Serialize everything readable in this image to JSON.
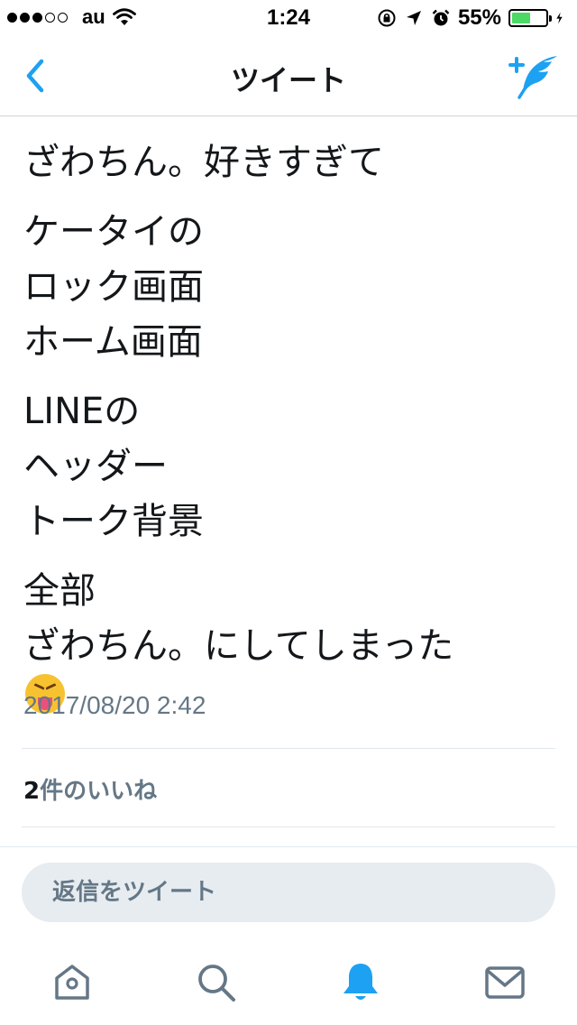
{
  "status_bar": {
    "signal_dots_filled": 3,
    "signal_dots_total": 5,
    "carrier": "au",
    "time": "1:24",
    "battery_percent": "55%",
    "battery_level": 0.55
  },
  "nav": {
    "title": "ツイート",
    "back_icon": "chevron-left-icon",
    "compose_icon": "compose-tweet-icon",
    "accent_color": "#1da1f2"
  },
  "tweet": {
    "paragraphs": [
      [
        "ざわちん。好きすぎて"
      ],
      [
        "ケータイの",
        "ロック画面",
        "ホーム画面"
      ],
      [
        "LINEの",
        "ヘッダー",
        "トーク背景"
      ],
      [
        "全部",
        "ざわちん。にしてしまった"
      ]
    ],
    "emoji": "squinting-face-with-tongue",
    "timestamp": "2017/08/20 2:42"
  },
  "likes": {
    "count": "2",
    "label": "件のいいね"
  },
  "reply": {
    "placeholder": "返信をツイート"
  },
  "tabbar": {
    "tabs": [
      {
        "name": "home",
        "icon": "home-icon",
        "active": false
      },
      {
        "name": "search",
        "icon": "search-icon",
        "active": false
      },
      {
        "name": "notifications",
        "icon": "bell-icon",
        "active": true
      },
      {
        "name": "messages",
        "icon": "mail-icon",
        "active": false
      }
    ],
    "active_color": "#1da1f2",
    "inactive_color": "#657786"
  }
}
